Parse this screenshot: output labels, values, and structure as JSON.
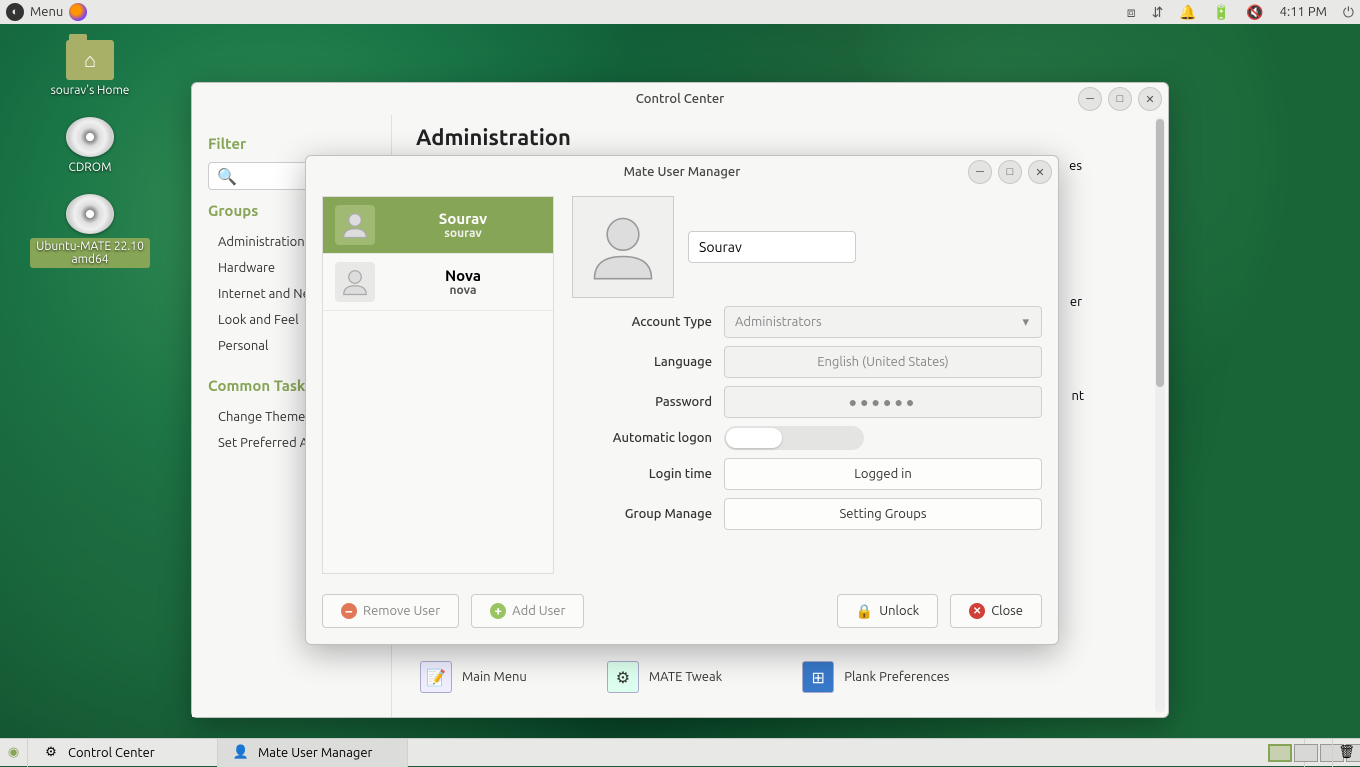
{
  "top_panel": {
    "menu_label": "Menu",
    "clock": "4:11 PM"
  },
  "desktop_icons": {
    "home": "sourav's Home",
    "cdrom": "CDROM",
    "iso": "Ubuntu-MATE 22.10 amd64"
  },
  "control_center": {
    "title": "Control Center",
    "sidebar": {
      "filter_heading": "Filter",
      "groups_heading": "Groups",
      "common_heading": "Common Tasks",
      "groups": [
        "Administration",
        "Hardware",
        "Internet and Network",
        "Look and Feel",
        "Personal"
      ],
      "tasks": [
        "Change Theme",
        "Set Preferred Applications"
      ]
    },
    "main_heading": "Administration",
    "partial_item": "es",
    "partial_item2": "er",
    "partial_item3": "nt",
    "items": {
      "main_menu": "Main Menu",
      "mate_tweak": "MATE Tweak",
      "plank": "Plank Preferences"
    }
  },
  "user_manager": {
    "title": "Mate User Manager",
    "users": [
      {
        "display": "Sourav",
        "username": "sourav",
        "selected": true
      },
      {
        "display": "Nova",
        "username": "nova",
        "selected": false
      }
    ],
    "name_value": "Sourav",
    "labels": {
      "account_type": "Account Type",
      "language": "Language",
      "password": "Password",
      "auto_logon": "Automatic logon",
      "login_time": "Login time",
      "group_manage": "Group Manage"
    },
    "values": {
      "account_type": "Administrators",
      "language": "English (United States)",
      "password": "●●●●●●",
      "login_time": "Logged in",
      "group_manage": "Setting Groups"
    },
    "buttons": {
      "remove": "Remove User",
      "add": "Add User",
      "unlock": "Unlock",
      "close": "Close"
    }
  },
  "bottom_panel": {
    "task1": "Control Center",
    "task2": "Mate User Manager"
  }
}
